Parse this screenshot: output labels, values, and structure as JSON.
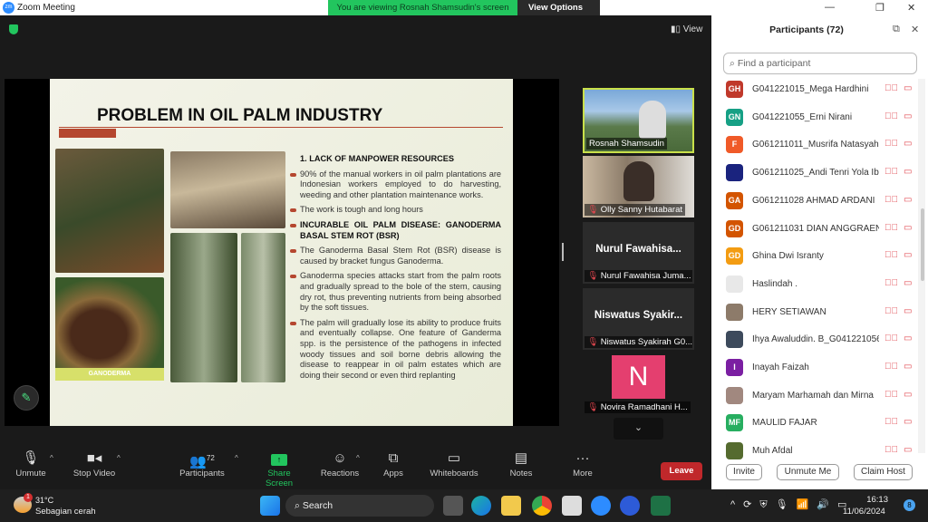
{
  "window": {
    "title": "Zoom Meeting",
    "logo": "zm"
  },
  "banner": {
    "text": "You are viewing Rosnah Shamsudin's screen",
    "view_options": "View Options"
  },
  "top": {
    "view_label": "View"
  },
  "slide": {
    "title": "PROBLEM IN OIL PALM INDUSTRY",
    "image_caption": "GANODERMA",
    "points": [
      {
        "text": "1. LACK OF MANPOWER RESOURCES",
        "type": "heading-numbered"
      },
      {
        "text": "90% of the manual workers in oil palm plantations are Indonesian workers employed to do harvesting, weeding and other plantation maintenance works.",
        "type": "bullet"
      },
      {
        "text": "The work is tough and long hours",
        "type": "bullet"
      },
      {
        "text": "INCURABLE OIL PALM DISEASE: GANODERMA BASAL STEM ROT (BSR)",
        "type": "heading"
      },
      {
        "text": "The Ganoderma Basal Stem Rot (BSR) disease is caused by bracket fungus Ganoderma.",
        "type": "bullet"
      },
      {
        "text": "Ganoderma species attacks start from the palm roots and gradually spread to the bole of the stem, causing dry rot, thus preventing nutrients from being absorbed by the soft tissues.",
        "type": "bullet"
      },
      {
        "text": "The palm will gradually lose its ability to produce fruits and eventually collapse. One feature of Ganderma spp. is the persistence of the pathogens in infected woody tissues and soil borne debris allowing the disease to reappear in oil palm estates which are doing their second or even third replanting",
        "type": "bullet"
      }
    ]
  },
  "video_tiles": [
    {
      "name": "Rosnah Shamsudin",
      "active_speaker": true
    },
    {
      "name": "Olly Sanny Hutabarat"
    },
    {
      "display": "Nurul Fawahisa...",
      "name": "Nurul Fawahisa Juma..."
    },
    {
      "display": "Niswatus Syakir...",
      "name": "Niswatus Syakirah G0..."
    },
    {
      "avatar_letter": "N",
      "name": "Novira Ramadhani H..."
    }
  ],
  "toolbar": {
    "unmute": "Unmute",
    "stop_video": "Stop Video",
    "participants": "Participants",
    "participants_count": "72",
    "share_screen": "Share Screen",
    "reactions": "Reactions",
    "apps": "Apps",
    "whiteboards": "Whiteboards",
    "notes": "Notes",
    "more": "More",
    "leave": "Leave"
  },
  "panel": {
    "title": "Participants (72)",
    "search_placeholder": "Find a participant",
    "participants": [
      {
        "initials": "GH",
        "color": "#c0392b",
        "name": "G041221015_Mega Hardhini"
      },
      {
        "initials": "GN",
        "color": "#16a085",
        "name": "G041221055_Erni Nirani"
      },
      {
        "initials": "F",
        "color": "#f05a28",
        "name": "G061211011_Musrifa Natasyah"
      },
      {
        "initials": "",
        "color": "#1a237e",
        "name": "G061211025_Andi Tenri Yola Ib..."
      },
      {
        "initials": "GA",
        "color": "#d35400",
        "name": "G061211028 AHMAD ARDANI"
      },
      {
        "initials": "GD",
        "color": "#d35400",
        "name": "G061211031 DIAN ANGGRAENI..."
      },
      {
        "initials": "GD",
        "color": "#f39c12",
        "name": "Ghina Dwi Isranty"
      },
      {
        "initials": "",
        "color": "#e8e8e8",
        "name": "Haslindah ."
      },
      {
        "initials": "",
        "color": "#8d7b6a",
        "name": "HERY SETIAWAN"
      },
      {
        "initials": "",
        "color": "#3d4a5c",
        "name": "Ihya Awaluddin. B_G041221056"
      },
      {
        "initials": "I",
        "color": "#7b1fa2",
        "name": "Inayah Faizah"
      },
      {
        "initials": "",
        "color": "#a1887f",
        "name": "Maryam Marhamah dan Mirna"
      },
      {
        "initials": "MF",
        "color": "#27ae60",
        "name": "MAULID FAJAR"
      },
      {
        "initials": "",
        "color": "#556b2f",
        "name": "Muh Afdal"
      }
    ],
    "invite": "Invite",
    "unmute_me": "Unmute Me",
    "claim_host": "Claim Host"
  },
  "taskbar": {
    "weather_temp": "31°C",
    "weather_desc": "Sebagian cerah",
    "weather_badge": "1",
    "search": "Search",
    "time": "16:13",
    "date": "11/06/2024",
    "notif_count": "8"
  }
}
